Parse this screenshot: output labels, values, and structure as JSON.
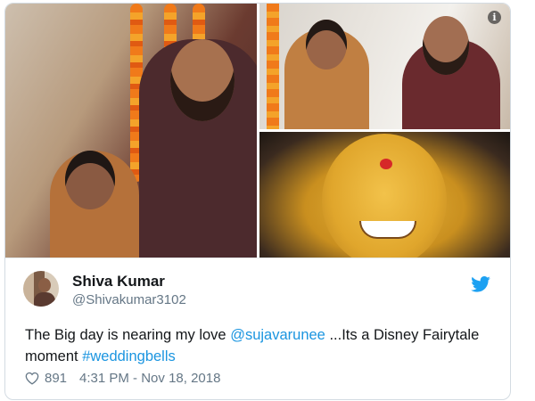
{
  "tweet": {
    "author_name": "Shiva Kumar",
    "author_handle": "@Shivakumar3102",
    "text_before": "The Big day is nearing my love ",
    "mention": "@sujavarunee",
    "text_middle": " ...Its a Disney Fairytale moment ",
    "hashtag": "#weddingbells",
    "likes": "891",
    "timestamp": "4:31 PM - Nov 18, 2018"
  },
  "media": {
    "info_glyph": "i"
  },
  "icons": {
    "bird": "twitter-bird-icon",
    "heart": "heart-icon",
    "info": "info-icon"
  },
  "colors": {
    "link": "#1b95e0",
    "text": "#14171a",
    "muted": "#657786",
    "border": "#d3dbe2"
  }
}
